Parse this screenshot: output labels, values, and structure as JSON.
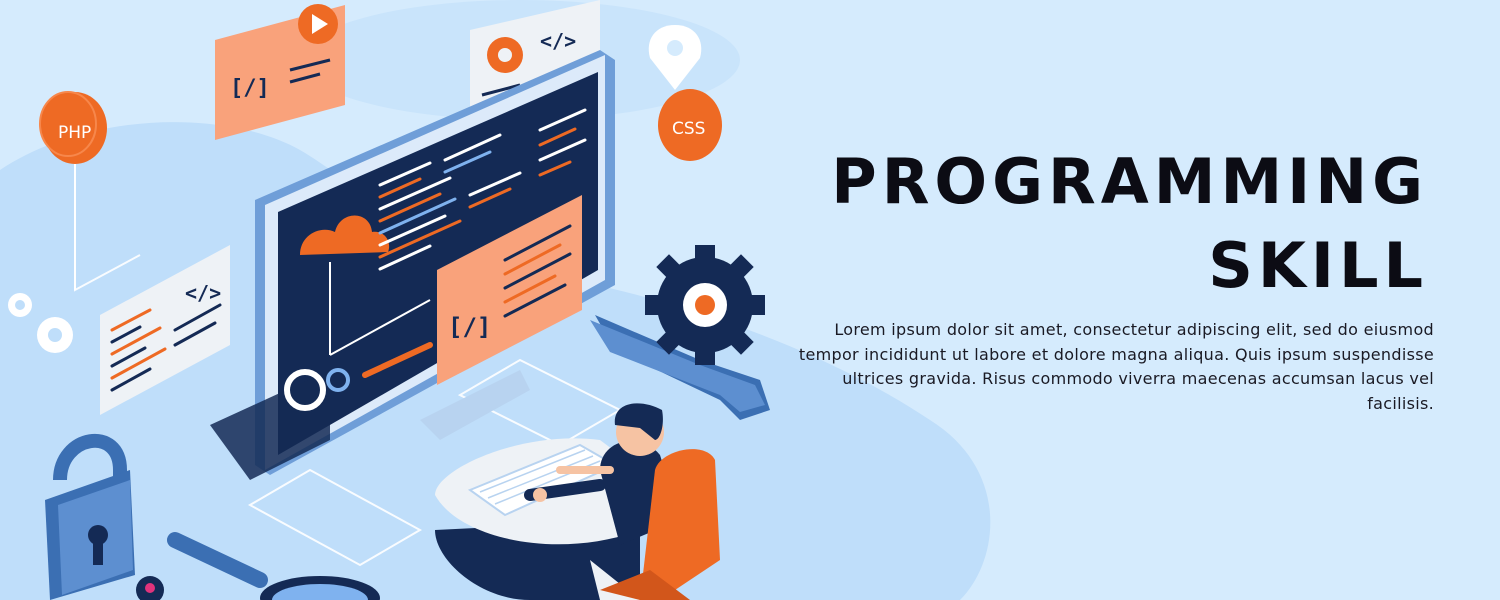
{
  "banner": {
    "title_line1": "PROGRAMMING",
    "title_line2": "SKILL",
    "body": "Lorem ipsum dolor sit amet, consectetur adipiscing elit, sed do eiusmod tempor incididunt ut labore et dolore magna aliqua. Quis ipsum suspendisse ultrices gravida. Risus commodo viverra maecenas accumsan lacus vel facilisis."
  },
  "illustration": {
    "php_label": "PHP",
    "css_label": "CSS",
    "code_tag": "[/]",
    "close_tag": "</>"
  },
  "colors": {
    "background": "#d5ebfd",
    "blob": "#bfdefa",
    "navy": "#142a55",
    "orange": "#ee6a24",
    "peach": "#f9a27b",
    "mid_blue": "#3b6fb3"
  }
}
